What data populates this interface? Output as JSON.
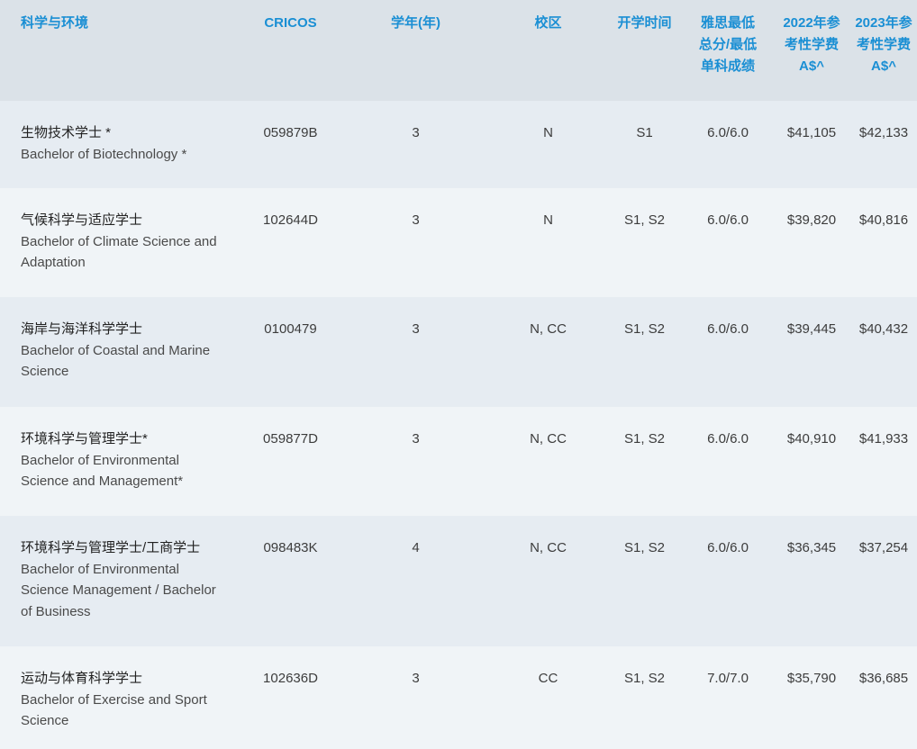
{
  "header": {
    "name": "科学与环境",
    "cricos": "CRICOS",
    "years": "学年(年)",
    "campus": "校区",
    "intake": "开学时间",
    "ielts": "雅思最低\n总分/最低\n单科成绩",
    "fee2022": "2022年参\n考性学费\nA$^",
    "fee2023": "2023年参\n考性学费\nA$^"
  },
  "rows": [
    {
      "zh": "生物技术学士 *",
      "en": "Bachelor of Biotechnology *",
      "cricos": "059879B",
      "years": "3",
      "campus": "N",
      "intake": "S1",
      "ielts": "6.0/6.0",
      "fee2022": "$41,105",
      "fee2023": "$42,133"
    },
    {
      "zh": "气候科学与适应学士",
      "en": "Bachelor of Climate Science and Adaptation",
      "cricos": "102644D",
      "years": "3",
      "campus": "N",
      "intake": "S1, S2",
      "ielts": "6.0/6.0",
      "fee2022": "$39,820",
      "fee2023": "$40,816"
    },
    {
      "zh": "海岸与海洋科学学士",
      "en": "Bachelor of Coastal and Marine Science",
      "cricos": "0100479",
      "years": "3",
      "campus": "N, CC",
      "intake": "S1, S2",
      "ielts": "6.0/6.0",
      "fee2022": "$39,445",
      "fee2023": "$40,432"
    },
    {
      "zh": "环境科学与管理学士*",
      "en": "Bachelor of Environmental Science and Management*",
      "cricos": "059877D",
      "years": "3",
      "campus": "N, CC",
      "intake": "S1, S2",
      "ielts": "6.0/6.0",
      "fee2022": "$40,910",
      "fee2023": "$41,933"
    },
    {
      "zh": "环境科学与管理学士/工商学士",
      "en": "Bachelor of Environmental Science Management / Bachelor of Business",
      "cricos": "098483K",
      "years": "4",
      "campus": "N, CC",
      "intake": "S1, S2",
      "ielts": "6.0/6.0",
      "fee2022": "$36,345",
      "fee2023": "$37,254"
    },
    {
      "zh": "运动与体育科学学士",
      "en": "Bachelor of Exercise and Sport Science",
      "cricos": "102636D",
      "years": "3",
      "campus": "CC",
      "intake": "S1, S2",
      "ielts": "7.0/7.0",
      "fee2022": "$35,790",
      "fee2023": "$36,685"
    }
  ]
}
